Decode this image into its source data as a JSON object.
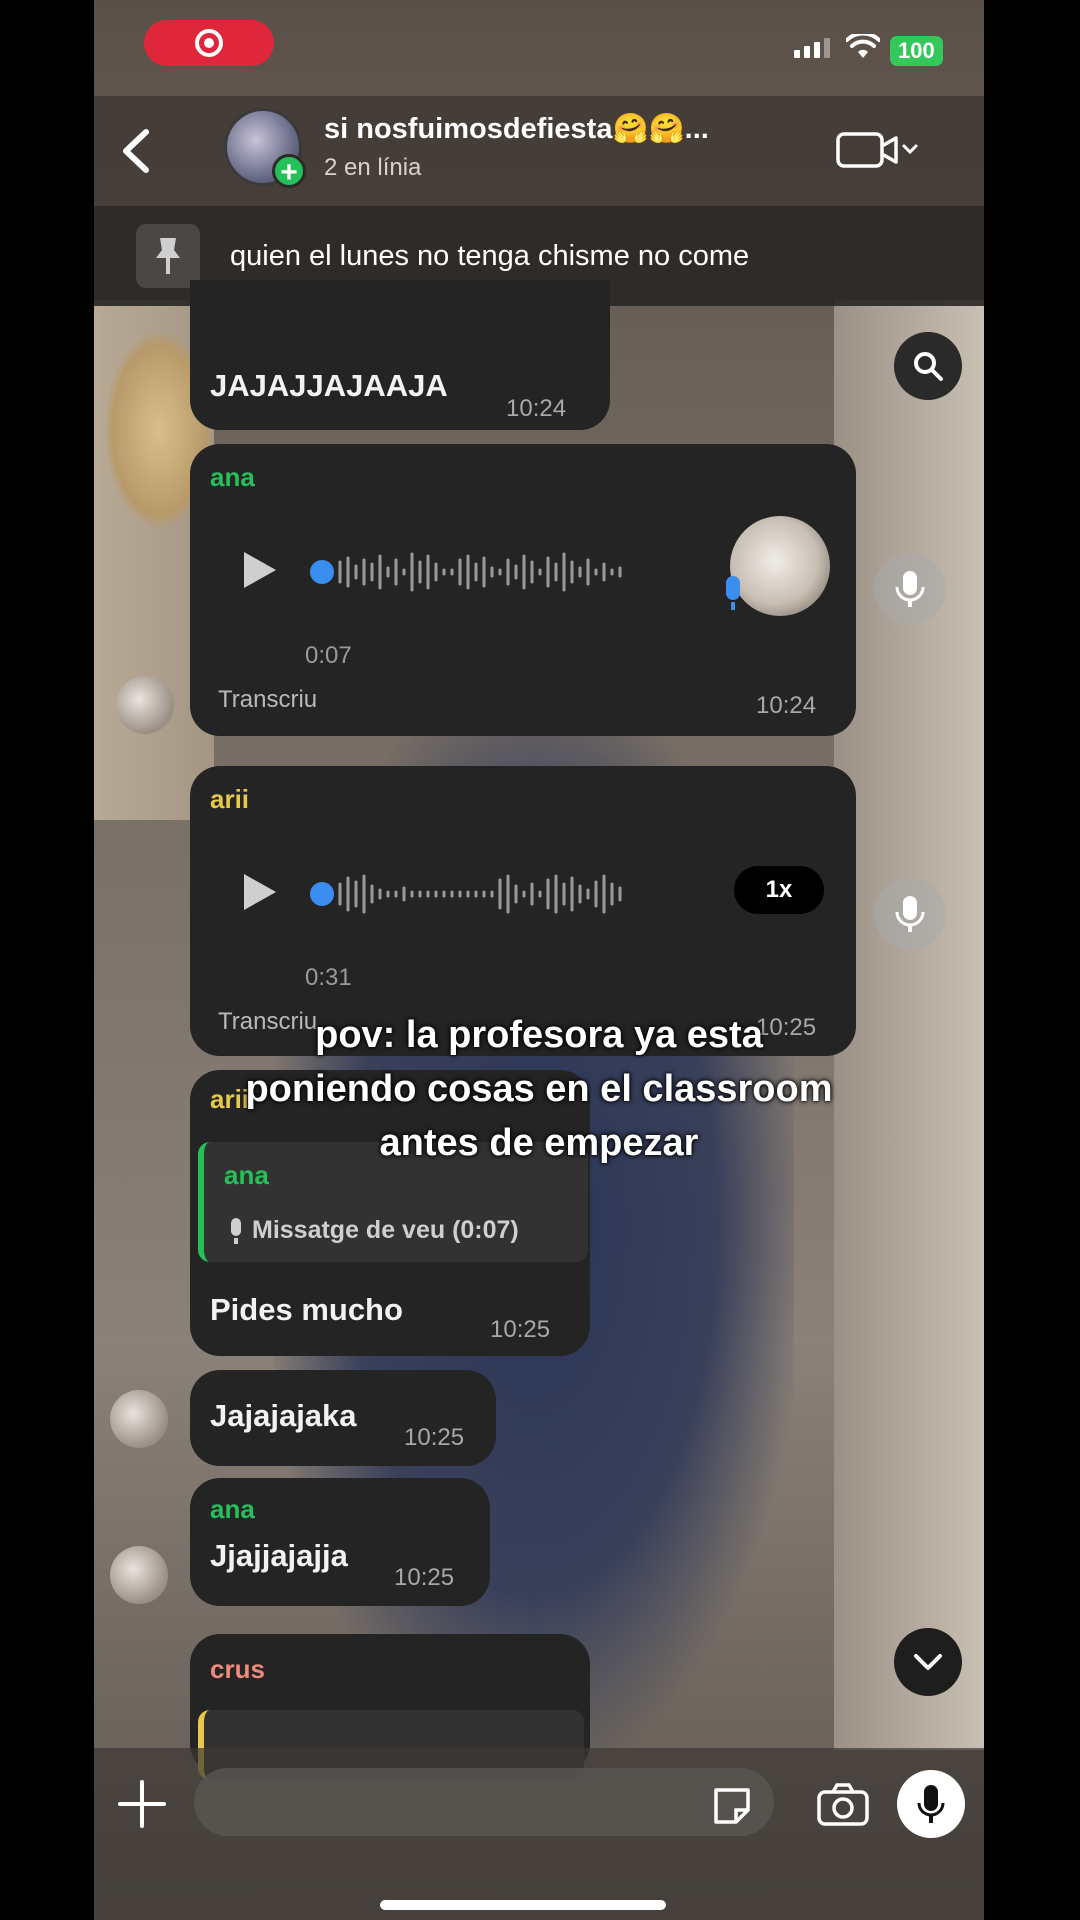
{
  "status": {
    "battery": "100"
  },
  "header": {
    "title": "si nosfuimosdefiesta🤗🤗...",
    "subtitle": "2 en línia"
  },
  "pinned": {
    "text": "quien el lunes no tenga chisme no come"
  },
  "messages": {
    "m1": {
      "text": "JAJAJJAJAAJA",
      "time": "10:24"
    },
    "m2": {
      "sender": "ana",
      "duration": "0:07",
      "transcribe": "Transcriu",
      "time": "10:24"
    },
    "m3": {
      "sender": "arii",
      "duration": "0:31",
      "speed": "1x",
      "transcribe": "Transcriu",
      "time": "10:25"
    },
    "m4": {
      "sender": "arii",
      "reply_sender": "ana",
      "reply_text": "Missatge de veu (0:07)",
      "text": "Pides mucho",
      "time": "10:25"
    },
    "m5": {
      "text": "Jajajajaka",
      "time": "10:25"
    },
    "m6": {
      "sender": "ana",
      "text": "Jjajjajajja",
      "time": "10:25"
    },
    "m7": {
      "sender": "crus"
    }
  },
  "overlay": {
    "line1": "pov: la profesora ya esta",
    "line2": "poniendo cosas en el classroom",
    "line3": "antes de empezar"
  },
  "colors": {
    "green": "#25c05a",
    "yellow": "#e6c84b",
    "pink": "#f08a7a",
    "bubble": "#242424"
  }
}
